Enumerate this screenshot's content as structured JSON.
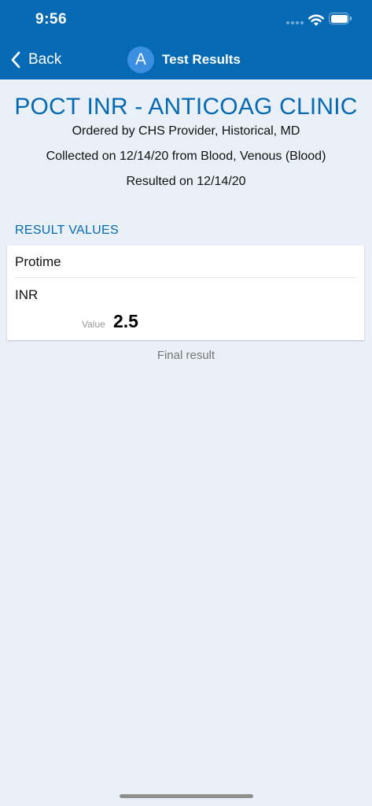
{
  "status_bar": {
    "time": "9:56"
  },
  "nav": {
    "back_label": "Back",
    "avatar_initial": "A",
    "title": "Test Results"
  },
  "test": {
    "title": "POCT INR - ANTICOAG CLINIC",
    "ordered_by": "Ordered by CHS Provider, Historical, MD",
    "collected": "Collected on 12/14/20 from Blood, Venous (Blood)",
    "resulted": "Resulted on 12/14/20"
  },
  "results": {
    "section_label": "RESULT VALUES",
    "panel_name": "Protime",
    "component_name": "INR",
    "value_label": "Value",
    "value": "2.5",
    "status": "Final result"
  },
  "colors": {
    "header_bg": "#0569b4",
    "accent_text": "#0669b2",
    "avatar_bg": "#3b8fe0",
    "page_bg": "#e9f0f7"
  },
  "icons": {
    "back": "chevron-left-icon",
    "wifi": "wifi-icon",
    "battery": "battery-icon",
    "signal": "cellular-signal-icon"
  }
}
